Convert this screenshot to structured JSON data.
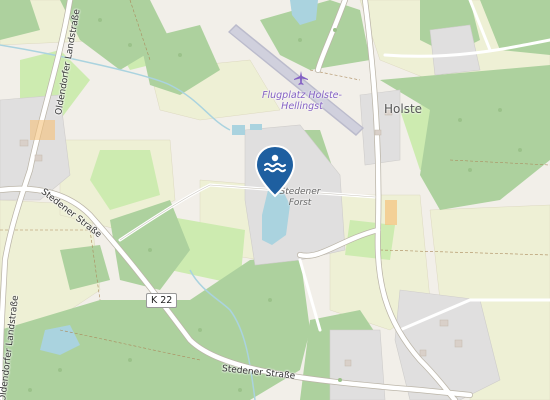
{
  "map": {
    "labels": {
      "town": "Holste",
      "airport_name": "Flugplatz Holste-Hellingst",
      "lake_name": "Stedener Forst",
      "road_ref": "K 22",
      "street_south": "Stedener Straße",
      "street_west": "Stedener Straße",
      "road_north": "Oldendorfer Landstraße",
      "road_west": "Oldendorfer Landstraße"
    },
    "marker": {
      "icon": "swimming-water-icon",
      "color": "#1e5fa0"
    },
    "airport_icon": "airplane-icon",
    "colors": {
      "background": "#f2efe9",
      "forest": "#add19e",
      "meadow": "#cdebb0",
      "farmland": "#eef0d5",
      "water": "#aad3df",
      "residential": "#e0dfdf",
      "road": "#ffffff"
    }
  }
}
